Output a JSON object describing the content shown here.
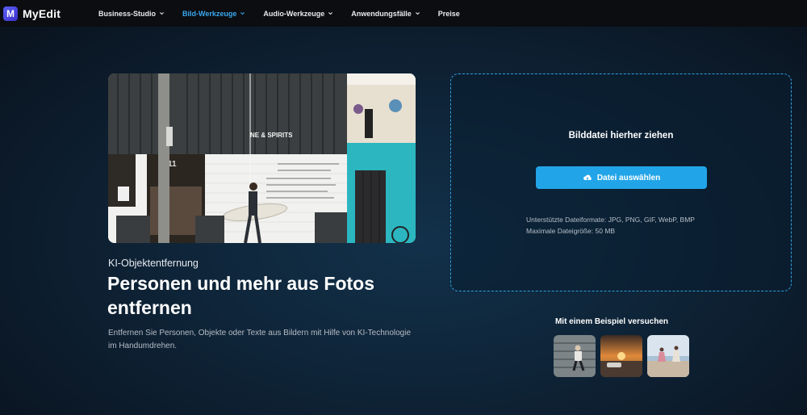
{
  "brand": {
    "name": "MyEdit",
    "mark": "M"
  },
  "nav": [
    {
      "label": "Business-Studio",
      "dropdown": true
    },
    {
      "label": "Bild-Werkzeuge",
      "dropdown": true,
      "active": true
    },
    {
      "label": "Audio-Werkzeuge",
      "dropdown": true
    },
    {
      "label": "Anwendungsfälle",
      "dropdown": true
    },
    {
      "label": "Preise",
      "dropdown": false
    }
  ],
  "hero": {
    "image_sign": "NE & SPIRITS",
    "image_number": "11",
    "subtitle": "KI-Objektentfernung",
    "headline": "Personen und mehr aus Fotos entfernen",
    "description": "Entfernen Sie Personen, Objekte oder Texte aus Bildern mit Hilfe von KI-Technologie im Handumdrehen."
  },
  "upload": {
    "title": "Bilddatei hierher ziehen",
    "button_label": "Datei auswählen",
    "formats": "Unterstützte Dateiformate: JPG, PNG, GIF, WebP, BMP",
    "max_size": "Maximale Dateigröße: 50 MB"
  },
  "examples": {
    "title": "Mit einem Beispiel versuchen"
  },
  "colors": {
    "accent": "#22a5e8",
    "nav_active": "#3aa8f0",
    "dashed_border": "#2ea0e0"
  }
}
